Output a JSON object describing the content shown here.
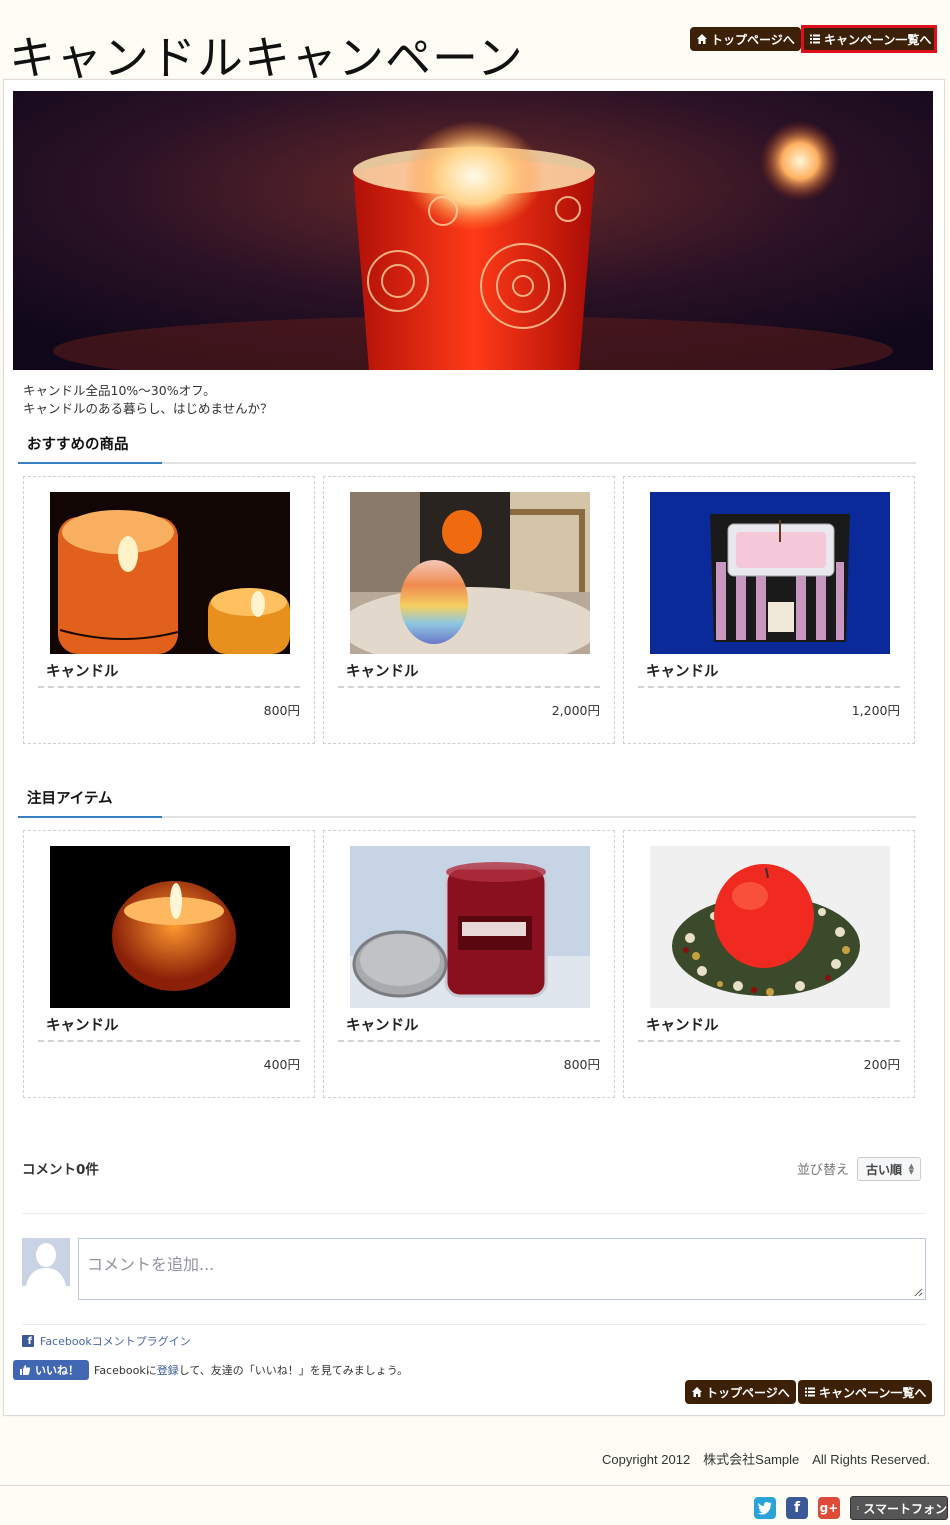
{
  "header": {
    "title": "キャンドルキャンペーン",
    "nav": {
      "top_page": "トップページへ",
      "campaign_list": "キャンペーン一覧へ"
    }
  },
  "intro": {
    "line1": "キャンドル全品10%～30%オフ。",
    "line2": "キャンドルのある暮らし、はじめませんか？"
  },
  "sections": [
    {
      "heading": "おすすめの商品",
      "items": [
        {
          "name": "キャンドル",
          "price": "800円"
        },
        {
          "name": "キャンドル",
          "price": "2,000円"
        },
        {
          "name": "キャンドル",
          "price": "1,200円"
        }
      ]
    },
    {
      "heading": "注目アイテム",
      "items": [
        {
          "name": "キャンドル",
          "price": "400円"
        },
        {
          "name": "キャンドル",
          "price": "800円"
        },
        {
          "name": "キャンドル",
          "price": "200円"
        }
      ]
    }
  ],
  "comments": {
    "count_label": "コメント0件",
    "sort_label": "並び替え",
    "sort_value": "古い順",
    "placeholder": "コメントを追加...",
    "plugin_label": "Facebookコメントプラグイン"
  },
  "like": {
    "button_label": "いいね！",
    "text_before": "Facebookに",
    "link_text": "登録",
    "text_after": "して、友達の「いいね！」を見てみましょう。"
  },
  "bottom_nav": {
    "top_page": "トップページへ",
    "campaign_list": "キャンペーン一覧へ"
  },
  "footer": {
    "copyright": "Copyright 2012　株式会社Sample　All Rights Reserved.",
    "smartphone_label": "スマートフォン"
  },
  "colors": {
    "nav_button": "#3c2108",
    "active_outline": "#e0101a",
    "heading_accent": "#3a7fc2",
    "facebook_blue": "#4267b2",
    "twitter": "#2aa3d9",
    "facebook": "#3b5998",
    "google_plus": "#dd4b39"
  },
  "icons": [
    "home-icon",
    "list-icon",
    "twitter-icon",
    "facebook-icon",
    "google-plus-icon",
    "smartphone-icon",
    "thumbs-up-icon"
  ]
}
